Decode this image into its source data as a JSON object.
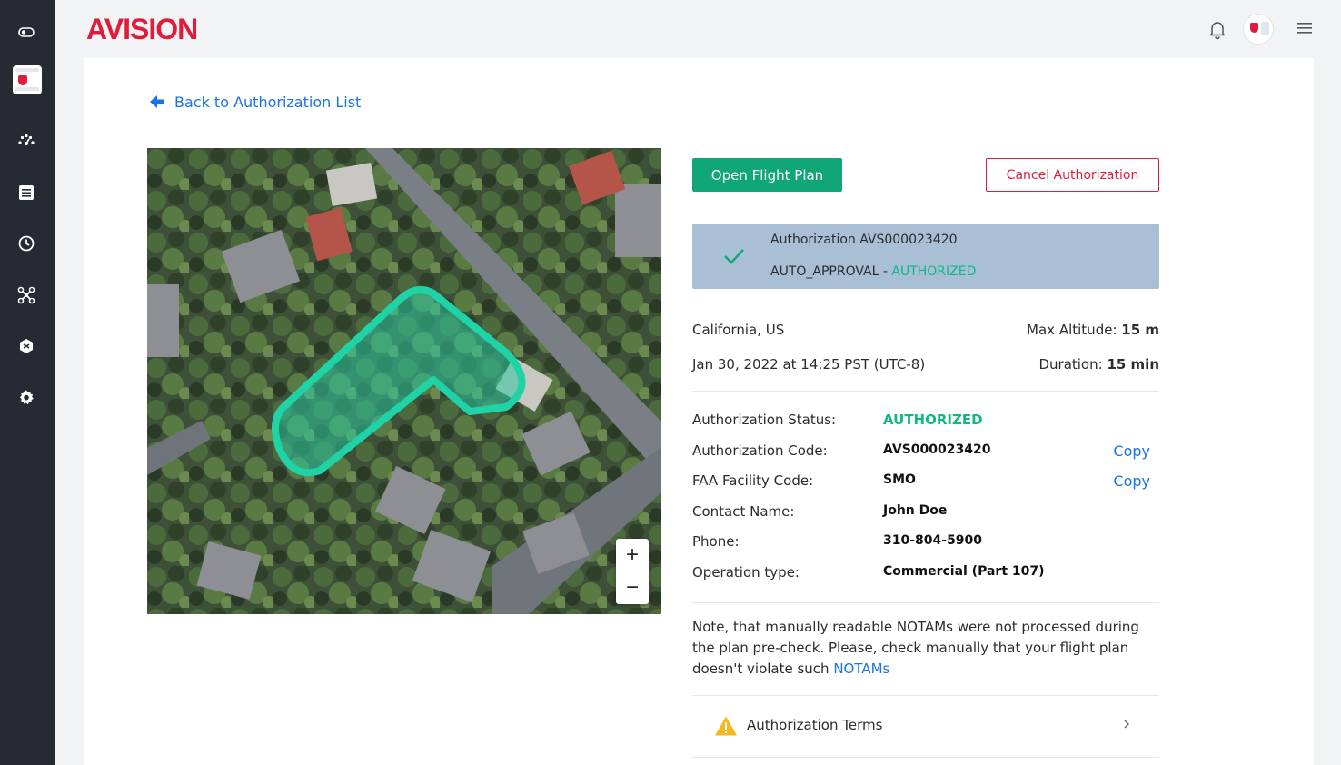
{
  "app": {
    "logo_text": "AVISION",
    "brand_color": "#e01c3c",
    "accent_green": "#10a676",
    "link_blue": "#1a73e8"
  },
  "sidebar": {
    "items": [
      {
        "icon": "toggle-icon"
      },
      {
        "icon": "project-thumbnail"
      },
      {
        "icon": "dashboard-gauge-icon"
      },
      {
        "icon": "list-icon"
      },
      {
        "icon": "clock-icon"
      },
      {
        "icon": "drone-icon"
      },
      {
        "icon": "box-icon"
      },
      {
        "icon": "gear-icon"
      }
    ]
  },
  "header": {
    "notification_icon": "bell-icon",
    "menu_icon": "hamburger-icon"
  },
  "back_link": {
    "label": "Back to Authorization List"
  },
  "map": {
    "zoom_in": "+",
    "zoom_out": "−"
  },
  "actions": {
    "open_flight_plan": "Open Flight Plan",
    "cancel_authorization": "Cancel Authorization"
  },
  "authorization": {
    "title": "Authorization AVS000023420",
    "type": "AUTO_APPROVAL - ",
    "status": "AUTHORIZED"
  },
  "summary": {
    "location": "California, US",
    "datetime": "Jan 30, 2022 at 14:25 PST (UTC-8)",
    "max_altitude_label": "Max Altitude: ",
    "max_altitude_value": "15 m",
    "duration_label": "Duration: ",
    "duration_value": "15 min"
  },
  "details": {
    "status_label": "Authorization Status:",
    "status_value": "AUTHORIZED",
    "code_label": "Authorization Code:",
    "code_value": "AVS000023420",
    "faa_label": "FAA Facility Code:",
    "faa_value": "SMO",
    "contact_label": "Contact Name:",
    "contact_value": "John Doe",
    "phone_label": "Phone:",
    "phone_value": "310-804-5900",
    "operation_label": "Operation type:",
    "operation_value": "Commercial (Part 107)",
    "copy_label": "Copy"
  },
  "note": {
    "text": "Note, that manually readable NOTAMs were not processed during the plan pre-check. Please, check manually that your flight plan doesn't violate such ",
    "link": "NOTAMs"
  },
  "terms": {
    "label": "Authorization Terms"
  }
}
